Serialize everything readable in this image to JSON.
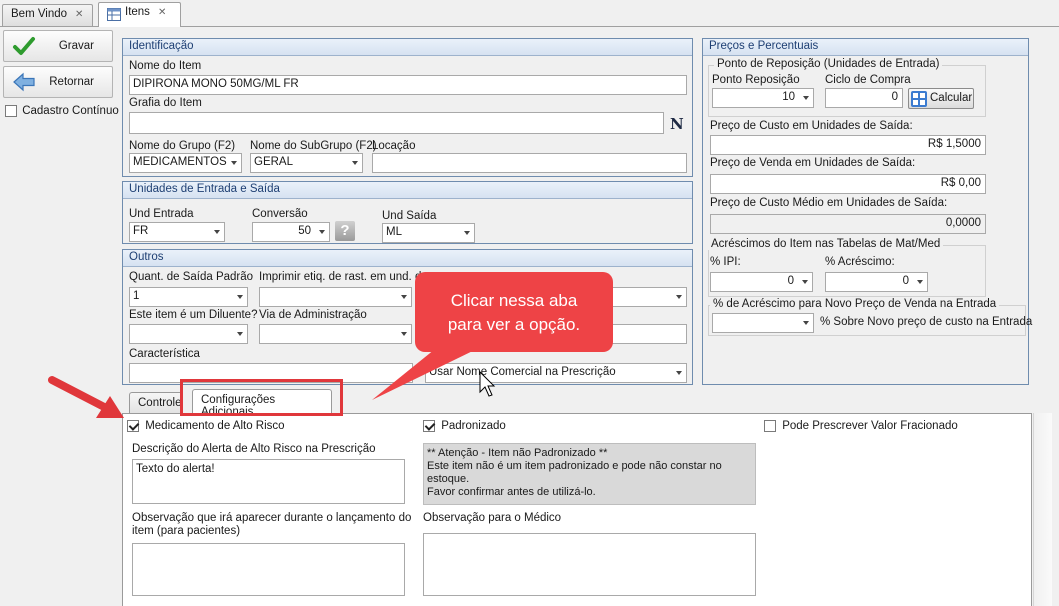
{
  "tabs": [
    {
      "label": "Bem Vindo",
      "close": "✕"
    },
    {
      "label": "Itens",
      "close": "✕"
    }
  ],
  "toolbar": {
    "save_label": "Gravar",
    "return_label": "Retornar",
    "continuous_label": "Cadastro Contínuo",
    "continuous_checked": false
  },
  "identificacao": {
    "title": "Identificação",
    "nome_label": "Nome do Item",
    "nome_value": "DIPIRONA MONO 50MG/ML FR",
    "grafia_label": "Grafia do Item",
    "grafia_value": "",
    "n_icon": "N",
    "grupo_label": "Nome do Grupo (F2)",
    "grupo_value": "MEDICAMENTOS",
    "subgrupo_label": "Nome do SubGrupo (F2)",
    "subgrupo_value": "GERAL",
    "locacao_label": "Locação",
    "locacao_value": ""
  },
  "unidades": {
    "title": "Unidades de Entrada e Saída",
    "entrada_label": "Und Entrada",
    "entrada_value": "FR",
    "conversao_label": "Conversão",
    "conversao_value": "50",
    "help_icon": "?",
    "saida_label": "Und Saída",
    "saida_value": "ML"
  },
  "outros": {
    "title": "Outros",
    "quant_label": "Quant. de Saída Padrão",
    "quant_value": "1",
    "imprimir_label": "Imprimir etiq. de rast. em und. de",
    "imprimir_value": "",
    "diluente_label": "Este item é um Diluente?",
    "diluente_value": "",
    "via_label": "Via de Administração",
    "via_value": "",
    "caracteristica_label": "Característica",
    "caracteristica_value": "",
    "nome_comercial_value": "Usar Nome Comercial na Prescrição"
  },
  "precos": {
    "title": "Preços e Percentuais",
    "ponto_group": "Ponto de Reposição (Unidades de Entrada)",
    "ponto_label": "Ponto Reposição",
    "ponto_value": "10",
    "ciclo_label": "Ciclo de Compra",
    "ciclo_value": "0",
    "calcular_label": "Calcular",
    "custo_label": "Preço de Custo em Unidades de Saída:",
    "custo_value": "R$ 1,5000",
    "venda_label": "Preço de Venda em Unidades de Saída:",
    "venda_value": "R$ 0,00",
    "custo_medio_label": "Preço de Custo Médio em Unidades de Saída:",
    "custo_medio_value": "0,0000",
    "acrescimos_group": "Acréscimos do Item nas Tabelas de Mat/Med",
    "ipi_label": "% IPI:",
    "ipi_value": "0",
    "acrescimo_label": "% Acréscimo:",
    "acrescimo_value": "0",
    "novo_preco_group": "% de Acréscimo para Novo Preço de Venda na Entrada",
    "novo_preco_value": "",
    "novo_preco_text": "% Sobre Novo preço de custo na Entrada"
  },
  "bottom_tabs": [
    {
      "label": "Controle"
    },
    {
      "label": "Configurações Adicionais"
    }
  ],
  "config": {
    "alto_risco_label": "Medicamento de Alto Risco",
    "alto_risco_checked": true,
    "padronizado_label": "Padronizado",
    "padronizado_checked": true,
    "fracionado_label": "Pode Prescrever Valor Fracionado",
    "fracionado_checked": false,
    "alerta_label": "Descrição do Alerta de Alto Risco na Prescrição",
    "alerta_value": "Texto do alerta!",
    "info_lines": [
      "** Atenção - Item não Padronizado **",
      "Este item não é um item padronizado e pode não constar no estoque.",
      "Favor confirmar antes de utilizá-lo."
    ],
    "obs_paciente_label_1": "Observação que irá aparecer durante o lançamento do",
    "obs_paciente_label_2": "item (para pacientes)",
    "obs_medico_label": "Observação para o Médico"
  },
  "annotation": {
    "line1": "Clicar nessa aba",
    "line2": "para ver a opção."
  },
  "colors": {
    "accent_red": "#ee4346",
    "group_header": "#d6e2f1"
  }
}
